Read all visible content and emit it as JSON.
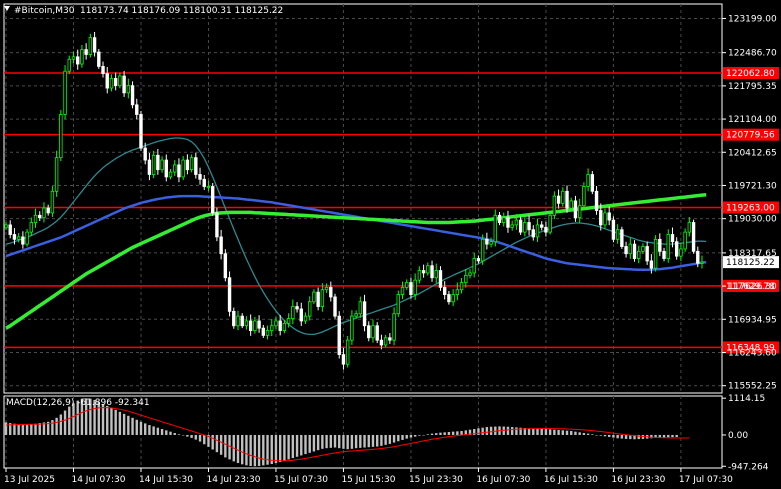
{
  "header": {
    "symbol": "#Bitcoin,M30",
    "ohlc": "118173.74 118176.09 118100.31 118125.22",
    "menu_icon": "triangle-down-icon"
  },
  "macd_header": "MACD(12,26,9) -61.896 -92.341",
  "colors": {
    "background": "#000000",
    "grid": "#4a4a4a",
    "axis": "#ffffff",
    "bull": "#00ff00",
    "bear": "#ffffff",
    "ma_fast": "#2b8a8f",
    "ma_mid": "#3a5fe0",
    "ma_slow": "#33ee33",
    "level": "#ff0000",
    "macd_hist": "#c0c0c0",
    "macd_signal": "#ff0000"
  },
  "chart_data": {
    "type": "candlestick",
    "price_ticks": [
      "123199.00",
      "122486.70",
      "121795.35",
      "121104.00",
      "120412.65",
      "119721.30",
      "119030.00",
      "118317.65",
      "117626.30",
      "116934.95",
      "116243.60",
      "115552.25"
    ],
    "price_tick_values": [
      123199.0,
      122486.7,
      121795.35,
      121104.0,
      120412.65,
      119721.3,
      119030.0,
      118317.65,
      117626.3,
      116934.95,
      116243.6,
      115552.25
    ],
    "ylim": [
      115400,
      123500
    ],
    "levels": [
      {
        "value": 122062.8,
        "label": "122062.80"
      },
      {
        "value": 120779.56,
        "label": "120779.56"
      },
      {
        "value": 119263.0,
        "label": "119263.00"
      },
      {
        "value": 117629.78,
        "label": "117629.78"
      },
      {
        "value": 116348.99,
        "label": "116348.99"
      }
    ],
    "current_price": {
      "value": 118125.22,
      "label": "118125.22"
    },
    "time_labels": [
      "13 Jul 2025",
      "14 Jul 07:30",
      "14 Jul 15:30",
      "14 Jul 23:30",
      "15 Jul 07:30",
      "15 Jul 15:30",
      "15 Jul 23:30",
      "16 Jul 07:30",
      "16 Jul 15:30",
      "16 Jul 23:30",
      "17 Jul 07:30"
    ],
    "time_label_index": [
      0,
      16,
      32,
      48,
      64,
      80,
      96,
      112,
      128,
      144,
      160
    ],
    "closes": [
      118900,
      118700,
      118600,
      118650,
      118500,
      118750,
      118950,
      119100,
      119050,
      119250,
      119150,
      119600,
      120300,
      121200,
      122100,
      122350,
      122400,
      122250,
      122550,
      122450,
      122800,
      122500,
      122200,
      122050,
      121750,
      121950,
      121800,
      122000,
      121650,
      121800,
      121400,
      121200,
      120500,
      120250,
      119950,
      120350,
      120050,
      120250,
      119900,
      120000,
      120150,
      119900,
      120250,
      120050,
      120300,
      119950,
      119850,
      119700,
      119700,
      119150,
      118650,
      118300,
      117800,
      117100,
      116800,
      117000,
      116800,
      116900,
      116700,
      116900,
      116750,
      116600,
      116700,
      116800,
      116900,
      116700,
      116850,
      116950,
      117200,
      117150,
      116900,
      117000,
      117300,
      117500,
      117200,
      117550,
      117600,
      117400,
      117000,
      116200,
      116000,
      116500,
      117000,
      117050,
      117300,
      116800,
      116550,
      116800,
      116500,
      116400,
      116550,
      116500,
      117050,
      117450,
      117600,
      117700,
      117450,
      117750,
      117950,
      117900,
      118050,
      117800,
      117950,
      117600,
      117450,
      117300,
      117450,
      117550,
      117700,
      117850,
      117900,
      118200,
      118150,
      118600,
      118500,
      118550,
      119100,
      118950,
      119050,
      118850,
      118900,
      119000,
      118750,
      118950,
      118800,
      118650,
      118900,
      118850,
      118750,
      119100,
      119500,
      119350,
      119600,
      119250,
      119400,
      119050,
      119300,
      119700,
      119950,
      119600,
      119200,
      118900,
      119150,
      119000,
      118600,
      118800,
      118450,
      118300,
      118500,
      118200,
      118350,
      118450,
      118150,
      118000,
      118600,
      118350,
      118200,
      118700,
      118550,
      118250,
      118400,
      118750,
      118950,
      118350,
      118100,
      118125
    ],
    "ma_fast": [
      118500,
      118520,
      118550,
      118580,
      118610,
      118640,
      118680,
      118720,
      118760,
      118800,
      118850,
      118910,
      118980,
      119060,
      119160,
      119270,
      119380,
      119490,
      119600,
      119710,
      119820,
      119920,
      120010,
      120090,
      120160,
      120220,
      120280,
      120330,
      120380,
      120420,
      120460,
      120490,
      120520,
      120550,
      120580,
      120610,
      120640,
      120660,
      120680,
      120700,
      120710,
      120710,
      120700,
      120680,
      120630,
      120550,
      120430,
      120280,
      120100,
      119900,
      119690,
      119470,
      119250,
      119030,
      118810,
      118600,
      118390,
      118190,
      118000,
      117820,
      117650,
      117500,
      117360,
      117230,
      117110,
      117000,
      116910,
      116830,
      116760,
      116700,
      116660,
      116630,
      116620,
      116620,
      116640,
      116670,
      116710,
      116750,
      116790,
      116830,
      116870,
      116900,
      116930,
      116960,
      116990,
      117020,
      117050,
      117080,
      117110,
      117140,
      117170,
      117200,
      117230,
      117270,
      117310,
      117350,
      117390,
      117430,
      117470,
      117520,
      117570,
      117620,
      117670,
      117720,
      117770,
      117810,
      117850,
      117890,
      117930,
      117970,
      118010,
      118050,
      118090,
      118140,
      118190,
      118240,
      118290,
      118340,
      118390,
      118440,
      118490,
      118540,
      118580,
      118620,
      118660,
      118700,
      118730,
      118760,
      118790,
      118820,
      118850,
      118880,
      118900,
      118920,
      118930,
      118940,
      118940,
      118930,
      118920,
      118900,
      118880,
      118850,
      118820,
      118790,
      118760,
      118730,
      118700,
      118670,
      118640,
      118610,
      118580,
      118560,
      118540,
      118530,
      118520,
      118510,
      118500,
      118500,
      118500,
      118510,
      118520,
      118530,
      118540,
      118550,
      118560,
      118560,
      118555
    ],
    "ma_mid": [
      118250,
      118280,
      118310,
      118340,
      118370,
      118400,
      118430,
      118460,
      118490,
      118520,
      118550,
      118580,
      118610,
      118640,
      118680,
      118720,
      118760,
      118800,
      118840,
      118880,
      118920,
      118960,
      119000,
      119040,
      119080,
      119120,
      119160,
      119200,
      119240,
      119270,
      119300,
      119330,
      119360,
      119380,
      119400,
      119420,
      119440,
      119455,
      119470,
      119480,
      119490,
      119495,
      119500,
      119500,
      119500,
      119500,
      119495,
      119490,
      119485,
      119480,
      119475,
      119470,
      119465,
      119460,
      119455,
      119450,
      119440,
      119430,
      119420,
      119410,
      119400,
      119390,
      119380,
      119370,
      119355,
      119340,
      119325,
      119310,
      119295,
      119280,
      119265,
      119250,
      119235,
      119220,
      119205,
      119190,
      119175,
      119160,
      119145,
      119130,
      119115,
      119100,
      119085,
      119070,
      119055,
      119040,
      119025,
      119010,
      118995,
      118980,
      118965,
      118950,
      118935,
      118920,
      118905,
      118890,
      118875,
      118860,
      118845,
      118830,
      118815,
      118800,
      118785,
      118770,
      118755,
      118740,
      118725,
      118710,
      118695,
      118680,
      118665,
      118650,
      118635,
      118620,
      118600,
      118580,
      118560,
      118530,
      118500,
      118470,
      118440,
      118410,
      118380,
      118350,
      118320,
      118290,
      118260,
      118230,
      118200,
      118180,
      118160,
      118140,
      118120,
      118100,
      118090,
      118080,
      118070,
      118060,
      118050,
      118040,
      118030,
      118020,
      118010,
      118000,
      117995,
      117990,
      117985,
      117980,
      117975,
      117970,
      117965,
      117965,
      117965,
      117970,
      117975,
      117980,
      117990,
      118000,
      118010,
      118025,
      118040,
      118055,
      118070,
      118085,
      118100,
      118115,
      118125
    ],
    "ma_slow": [
      116750,
      116800,
      116860,
      116920,
      116980,
      117040,
      117100,
      117160,
      117220,
      117280,
      117340,
      117400,
      117460,
      117520,
      117580,
      117640,
      117700,
      117760,
      117820,
      117880,
      117930,
      117980,
      118030,
      118080,
      118130,
      118180,
      118230,
      118280,
      118330,
      118380,
      118430,
      118470,
      118510,
      118550,
      118590,
      118630,
      118670,
      118710,
      118750,
      118790,
      118830,
      118870,
      118910,
      118950,
      118990,
      119030,
      119060,
      119090,
      119110,
      119130,
      119140,
      119150,
      119155,
      119160,
      119160,
      119160,
      119160,
      119160,
      119160,
      119155,
      119150,
      119145,
      119140,
      119135,
      119130,
      119125,
      119120,
      119115,
      119110,
      119105,
      119100,
      119095,
      119090,
      119085,
      119080,
      119075,
      119070,
      119065,
      119060,
      119055,
      119050,
      119045,
      119040,
      119035,
      119030,
      119025,
      119020,
      119015,
      119010,
      119005,
      119000,
      118995,
      118990,
      118985,
      118980,
      118975,
      118970,
      118965,
      118960,
      118955,
      118950,
      118950,
      118950,
      118950,
      118950,
      118950,
      118955,
      118960,
      118965,
      118970,
      118975,
      118980,
      118990,
      119000,
      119010,
      119020,
      119030,
      119040,
      119050,
      119060,
      119070,
      119080,
      119090,
      119100,
      119110,
      119120,
      119130,
      119140,
      119150,
      119160,
      119170,
      119180,
      119190,
      119200,
      119210,
      119220,
      119230,
      119240,
      119250,
      119260,
      119270,
      119280,
      119290,
      119300,
      119310,
      119320,
      119330,
      119340,
      119350,
      119360,
      119370,
      119380,
      119390,
      119400,
      119410,
      119420,
      119430,
      119440,
      119450,
      119460,
      119470,
      119480,
      119490,
      119500,
      119510,
      119520,
      119530
    ],
    "macd": {
      "ticks": [
        "1114.15",
        "0.00",
        "-947.264"
      ],
      "tick_values": [
        1114.15,
        0,
        -947.264
      ],
      "ylim": [
        -1000,
        1180
      ],
      "value": -61.896,
      "signal_value": -92.341,
      "histogram": [
        380,
        360,
        340,
        320,
        300,
        310,
        320,
        340,
        360,
        380,
        400,
        450,
        520,
        620,
        740,
        860,
        960,
        1040,
        1100,
        1110,
        1100,
        1060,
        1000,
        940,
        880,
        820,
        760,
        700,
        640,
        580,
        520,
        460,
        400,
        350,
        300,
        260,
        220,
        180,
        140,
        100,
        60,
        20,
        -10,
        -50,
        -90,
        -140,
        -200,
        -280,
        -360,
        -440,
        -520,
        -600,
        -680,
        -740,
        -800,
        -850,
        -890,
        -920,
        -940,
        -947,
        -940,
        -920,
        -900,
        -880,
        -850,
        -820,
        -780,
        -740,
        -700,
        -660,
        -620,
        -580,
        -540,
        -500,
        -460,
        -420,
        -400,
        -390,
        -380,
        -400,
        -420,
        -430,
        -420,
        -400,
        -390,
        -380,
        -370,
        -360,
        -350,
        -330,
        -300,
        -270,
        -230,
        -190,
        -150,
        -110,
        -80,
        -50,
        -20,
        0,
        20,
        40,
        55,
        70,
        80,
        90,
        100,
        110,
        120,
        140,
        160,
        180,
        200,
        220,
        240,
        250,
        255,
        260,
        255,
        250,
        240,
        230,
        220,
        210,
        200,
        195,
        190,
        185,
        180,
        170,
        160,
        150,
        140,
        130,
        120,
        100,
        80,
        60,
        40,
        20,
        0,
        -20,
        -40,
        -60,
        -80,
        -100,
        -110,
        -120,
        -125,
        -130,
        -125,
        -120,
        -110,
        -100,
        -90,
        -80,
        -75,
        -70,
        -66,
        -62
      ],
      "signal": [
        300,
        305,
        310,
        315,
        318,
        320,
        322,
        325,
        330,
        335,
        345,
        360,
        380,
        410,
        450,
        500,
        560,
        620,
        680,
        730,
        770,
        800,
        820,
        830,
        830,
        820,
        800,
        780,
        750,
        720,
        680,
        640,
        600,
        560,
        520,
        480,
        440,
        400,
        360,
        320,
        280,
        240,
        200,
        160,
        120,
        80,
        40,
        0,
        -50,
        -100,
        -160,
        -220,
        -280,
        -340,
        -400,
        -460,
        -520,
        -570,
        -620,
        -660,
        -700,
        -730,
        -750,
        -765,
        -775,
        -780,
        -780,
        -775,
        -765,
        -750,
        -730,
        -710,
        -690,
        -665,
        -640,
        -615,
        -590,
        -565,
        -545,
        -525,
        -510,
        -495,
        -485,
        -475,
        -465,
        -455,
        -445,
        -435,
        -425,
        -410,
        -395,
        -375,
        -355,
        -330,
        -305,
        -280,
        -255,
        -230,
        -205,
        -180,
        -155,
        -130,
        -110,
        -90,
        -70,
        -50,
        -35,
        -20,
        -5,
        10,
        25,
        40,
        55,
        70,
        85,
        100,
        115,
        130,
        145,
        155,
        165,
        175,
        180,
        185,
        190,
        192,
        194,
        195,
        195,
        194,
        192,
        189,
        186,
        182,
        177,
        170,
        162,
        153,
        143,
        131,
        118,
        104,
        89,
        73,
        57,
        40,
        24,
        8,
        -6,
        -20,
        -33,
        -45,
        -56,
        -66,
        -74,
        -81,
        -86,
        -89,
        -91,
        -92,
        -92,
        -92,
        -92
      ]
    }
  }
}
